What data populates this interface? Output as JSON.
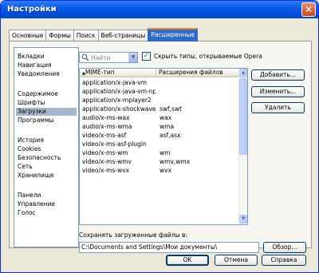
{
  "window": {
    "title": "Настройки",
    "close_glyph": "✕"
  },
  "tabs": [
    {
      "label": "Основные"
    },
    {
      "label": "Формы"
    },
    {
      "label": "Поиск"
    },
    {
      "label": "Веб-страницы"
    },
    {
      "label": "Расширенные",
      "active": true
    }
  ],
  "sidebar": {
    "items": [
      {
        "label": "Вкладки"
      },
      {
        "label": "Навигация"
      },
      {
        "label": "Уведомления"
      },
      {
        "label": "Содержимое"
      },
      {
        "label": "Шрифты"
      },
      {
        "label": "Загрузки",
        "selected": true
      },
      {
        "label": "Программы"
      },
      {
        "label": "История"
      },
      {
        "label": "Cookies"
      },
      {
        "label": "Безопасность"
      },
      {
        "label": "Сеть"
      },
      {
        "label": "Хранилище"
      },
      {
        "label": "Панели"
      },
      {
        "label": "Управление"
      },
      {
        "label": "Голос"
      }
    ]
  },
  "search": {
    "placeholder": "Найти"
  },
  "hide_types": {
    "checked": true,
    "label": "Скрыть типы, открываемые Opera"
  },
  "mime_table": {
    "columns": [
      "MIME-тип",
      "Расширения файлов"
    ],
    "rows": [
      {
        "type": "application/x-java-vm",
        "ext": ""
      },
      {
        "type": "application/x-java-vm-np...",
        "ext": ""
      },
      {
        "type": "application/x-mplayer2",
        "ext": ""
      },
      {
        "type": "application/x-shockwave-...",
        "ext": "swf,swt"
      },
      {
        "type": "audio/x-ms-wax",
        "ext": "wax"
      },
      {
        "type": "audio/x-ms-wma",
        "ext": "wma"
      },
      {
        "type": "video/x-ms-asf",
        "ext": "asf,asx"
      },
      {
        "type": "video/x-ms-asf-plugin",
        "ext": ""
      },
      {
        "type": "video/x-ms-wm",
        "ext": "wm"
      },
      {
        "type": "video/x-ms-wmv",
        "ext": "wmv,wmx"
      },
      {
        "type": "video/x-ms-wvx",
        "ext": "wvx"
      }
    ]
  },
  "side_buttons": {
    "add": "Добавить...",
    "edit": "Изменить...",
    "delete": "Удалить"
  },
  "save": {
    "label": "Сохранять загруженные файлы в:",
    "path": "C:\\Documents and Settings\\Мои документы\\",
    "browse": "Обзор..."
  },
  "footer": {
    "ok": "OK",
    "cancel": "Отмена",
    "help": "Справка"
  }
}
